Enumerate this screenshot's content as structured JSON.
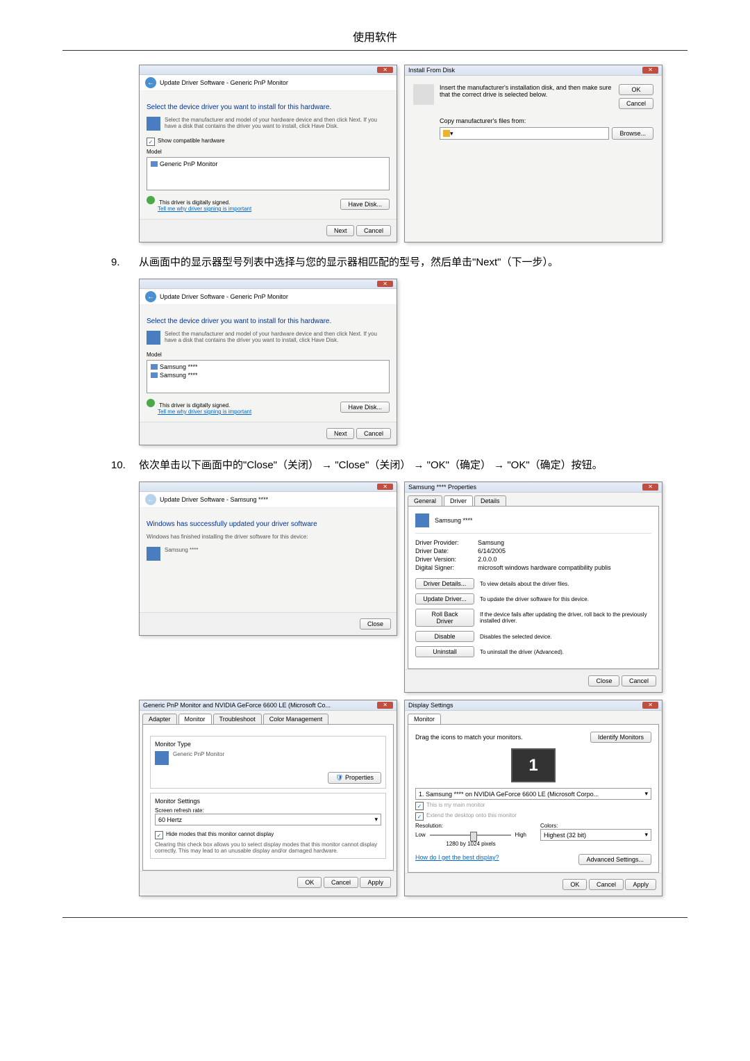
{
  "header": "使用软件",
  "step9": {
    "num": "9.",
    "text": "从画面中的显示器型号列表中选择与您的显示器相匹配的型号，然后单击\"Next\"（下一步）。"
  },
  "step10": {
    "num": "10.",
    "text": "依次单击以下画面中的\"Close\"（关闭） → \"Close\"（关闭） → \"OK\"（确定） → \"OK\"（确定）按钮。"
  },
  "dialog_update1": {
    "nav": "Update Driver Software - Generic PnP Monitor",
    "heading": "Select the device driver you want to install for this hardware.",
    "hint": "Select the manufacturer and model of your hardware device and then click Next. If you have a disk that contains the driver you want to install, click Have Disk.",
    "compat_check": "Show compatible hardware",
    "model_label": "Model",
    "model_item": "Generic PnP Monitor",
    "signed": "This driver is digitally signed.",
    "tell_link": "Tell me why driver signing is important",
    "have_disk": "Have Disk...",
    "next": "Next",
    "cancel": "Cancel"
  },
  "dialog_install": {
    "title": "Install From Disk",
    "text": "Insert the manufacturer's installation disk, and then make sure that the correct drive is selected below.",
    "ok": "OK",
    "cancel": "Cancel",
    "copy_label": "Copy manufacturer's files from:",
    "browse": "Browse..."
  },
  "dialog_update2": {
    "nav": "Update Driver Software - Generic PnP Monitor",
    "heading": "Select the device driver you want to install for this hardware.",
    "hint": "Select the manufacturer and model of your hardware device and then click Next. If you have a disk that contains the driver you want to install, click Have Disk.",
    "model_label": "Model",
    "model_item1": "Samsung ****",
    "model_item2": "Samsung ****",
    "signed": "This driver is digitally signed.",
    "tell_link": "Tell me why driver signing is important",
    "have_disk": "Have Disk...",
    "next": "Next",
    "cancel": "Cancel"
  },
  "dialog_success": {
    "nav": "Update Driver Software - Samsung ****",
    "heading": "Windows has successfully updated your driver software",
    "hint": "Windows has finished installing the driver software for this device:",
    "device": "Samsung ****",
    "close": "Close"
  },
  "dialog_props": {
    "title": "Samsung **** Properties",
    "tab_general": "General",
    "tab_driver": "Driver",
    "tab_details": "Details",
    "device": "Samsung ****",
    "provider_label": "Driver Provider:",
    "provider": "Samsung",
    "date_label": "Driver Date:",
    "date": "6/14/2005",
    "version_label": "Driver Version:",
    "version": "2.0.0.0",
    "signer_label": "Digital Signer:",
    "signer": "microsoft windows hardware compatibility publis",
    "btn_details": "Driver Details...",
    "desc_details": "To view details about the driver files.",
    "btn_update": "Update Driver...",
    "desc_update": "To update the driver software for this device.",
    "btn_rollback": "Roll Back Driver",
    "desc_rollback": "If the device fails after updating the driver, roll back to the previously installed driver.",
    "btn_disable": "Disable",
    "desc_disable": "Disables the selected device.",
    "btn_uninstall": "Uninstall",
    "desc_uninstall": "To uninstall the driver (Advanced).",
    "close": "Close",
    "cancel": "Cancel"
  },
  "dialog_monitor": {
    "title": "Generic PnP Monitor and NVIDIA GeForce 6600 LE (Microsoft Co...",
    "tab_adapter": "Adapter",
    "tab_monitor": "Monitor",
    "tab_trouble": "Troubleshoot",
    "tab_color": "Color Management",
    "type_label": "Monitor Type",
    "type": "Generic PnP Monitor",
    "btn_props": "Properties",
    "settings_label": "Monitor Settings",
    "refresh_label": "Screen refresh rate:",
    "refresh": "60 Hertz",
    "hide_check": "Hide modes that this monitor cannot display",
    "hide_desc": "Clearing this check box allows you to select display modes that this monitor cannot display correctly. This may lead to an unusable display and/or damaged hardware.",
    "ok": "OK",
    "cancel": "Cancel",
    "apply": "Apply"
  },
  "dialog_display": {
    "title": "Display Settings",
    "tab_monitor": "Monitor",
    "drag": "Drag the icons to match your monitors.",
    "identify": "Identify Monitors",
    "monitor_num": "1",
    "monitor_sel": "1. Samsung **** on NVIDIA GeForce 6600 LE (Microsoft Corpo...",
    "main_check": "This is my main monitor",
    "extend_check": "Extend the desktop onto this monitor",
    "res_label": "Resolution:",
    "low": "Low",
    "high": "High",
    "res_value": "1280 by 1024 pixels",
    "colors_label": "Colors:",
    "colors": "Highest (32 bit)",
    "best_link": "How do I get the best display?",
    "advanced": "Advanced Settings...",
    "ok": "OK",
    "cancel": "Cancel",
    "apply": "Apply"
  }
}
